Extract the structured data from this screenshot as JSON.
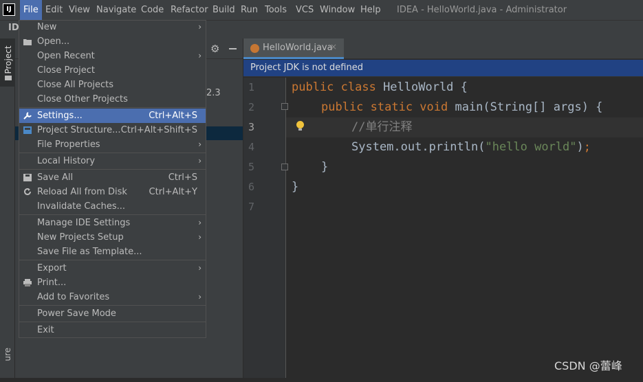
{
  "menubar": {
    "items": [
      "File",
      "Edit",
      "View",
      "Navigate",
      "Code",
      "Refactor",
      "Build",
      "Run",
      "Tools",
      "VCS",
      "Window",
      "Help"
    ],
    "active": "File",
    "window_title": "IDEA - HelloWorld.java - Administrator"
  },
  "nav_row_text": "IDI",
  "side_tabs": {
    "project": "Project",
    "structure": "ure"
  },
  "project_panel": {
    "partial_text": "2.3"
  },
  "editor": {
    "tab_label": "HelloWorld.java",
    "tab_close": "×",
    "banner": "Project JDK is not defined",
    "line_numbers": [
      "1",
      "2",
      "3",
      "4",
      "5",
      "6",
      "7"
    ],
    "current_line": 3,
    "code": {
      "l1_kw": "public class ",
      "l1_rest": "HelloWorld {",
      "l2_kw": "public static void ",
      "l2_rest": "main(String[] args) {",
      "l3_cmt": "//单行注释",
      "l4_pre": "System.out.println(",
      "l4_str": "\"hello world\"",
      "l4_post": ")",
      "l4_semi": ";",
      "l5": "}",
      "l6": "}"
    }
  },
  "watermark": "CSDN @蕾峰",
  "file_menu": {
    "items": [
      {
        "label": "New",
        "shortcut": "",
        "submenu": true
      },
      {
        "label": "Open...",
        "shortcut": "",
        "submenu": false
      },
      {
        "label": "Open Recent",
        "shortcut": "",
        "submenu": true
      },
      {
        "label": "Close Project",
        "shortcut": "",
        "submenu": false
      },
      {
        "label": "Close All Projects",
        "shortcut": "",
        "submenu": false
      },
      {
        "label": "Close Other Projects",
        "shortcut": "",
        "submenu": false
      },
      {
        "label": "Settings...",
        "shortcut": "Ctrl+Alt+S",
        "submenu": false
      },
      {
        "label": "Project Structure...",
        "shortcut": "Ctrl+Alt+Shift+S",
        "submenu": false
      },
      {
        "label": "File Properties",
        "shortcut": "",
        "submenu": true
      },
      {
        "label": "Local History",
        "shortcut": "",
        "submenu": true
      },
      {
        "label": "Save All",
        "shortcut": "Ctrl+S",
        "submenu": false
      },
      {
        "label": "Reload All from Disk",
        "shortcut": "Ctrl+Alt+Y",
        "submenu": false
      },
      {
        "label": "Invalidate Caches...",
        "shortcut": "",
        "submenu": false
      },
      {
        "label": "Manage IDE Settings",
        "shortcut": "",
        "submenu": true
      },
      {
        "label": "New Projects Setup",
        "shortcut": "",
        "submenu": true
      },
      {
        "label": "Save File as Template...",
        "shortcut": "",
        "submenu": false
      },
      {
        "label": "Export",
        "shortcut": "",
        "submenu": true
      },
      {
        "label": "Print...",
        "shortcut": "",
        "submenu": false
      },
      {
        "label": "Add to Favorites",
        "shortcut": "",
        "submenu": true
      },
      {
        "label": "Power Save Mode",
        "shortcut": "",
        "submenu": false
      },
      {
        "label": "Exit",
        "shortcut": "",
        "submenu": false
      }
    ],
    "selected": "Settings...",
    "arrow_glyph": "›"
  },
  "colors": {
    "accent": "#4b6eaf",
    "keyword": "#cc7832",
    "string": "#6a8759",
    "comment": "#808080"
  }
}
